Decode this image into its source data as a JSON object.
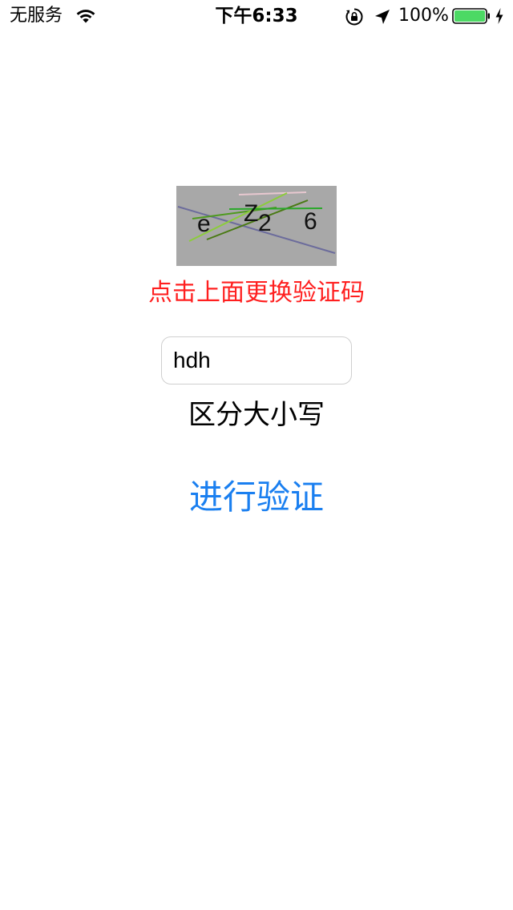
{
  "status_bar": {
    "carrier": "无服务",
    "time": "下午6:33",
    "battery_percent": "100%",
    "icons": [
      "wifi-icon",
      "rotation-lock-icon",
      "location-arrow-icon",
      "battery-icon",
      "charging-bolt-icon"
    ],
    "battery_level": 1.0,
    "battery_color": "#4cd964"
  },
  "captcha": {
    "characters": [
      "e",
      "Z",
      "2",
      "6"
    ],
    "background_color": "#a8a8a8"
  },
  "hint": {
    "text": "点击上面更换验证码",
    "color": "#ff1f1f"
  },
  "code_input": {
    "value": "hdh"
  },
  "case_note": "区分大小写",
  "verify_button": {
    "label": "进行验证",
    "color": "#1a7ff0"
  }
}
